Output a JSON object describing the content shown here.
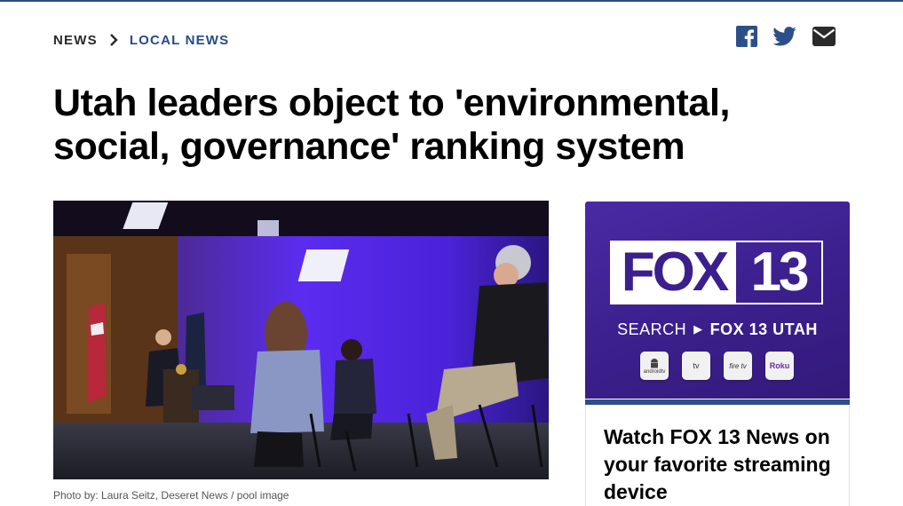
{
  "breadcrumb": {
    "parent": "NEWS",
    "current": "LOCAL NEWS"
  },
  "share": {
    "icons": [
      "facebook-icon",
      "twitter-icon",
      "email-icon"
    ]
  },
  "article": {
    "headline": "Utah leaders object to 'environmental, social, governance' ranking system",
    "photo_caption": "Photo by: Laura Seitz, Deseret News / pool image"
  },
  "promo": {
    "logo_left": "FOX",
    "logo_right": "13",
    "search_prefix": "SEARCH",
    "search_target": "FOX 13 UTAH",
    "apps": [
      {
        "name": "androidtv-app-icon",
        "label": "androidtv"
      },
      {
        "name": "appletv-app-icon",
        "label": "tv"
      },
      {
        "name": "firetv-app-icon",
        "label": "fire tv"
      },
      {
        "name": "roku-app-icon",
        "label": "Roku"
      }
    ],
    "title": "Watch FOX 13 News on your favorite streaming device"
  },
  "colors": {
    "accent": "#254c86",
    "promo_bg": "#3b1f8c",
    "text": "#000000"
  }
}
